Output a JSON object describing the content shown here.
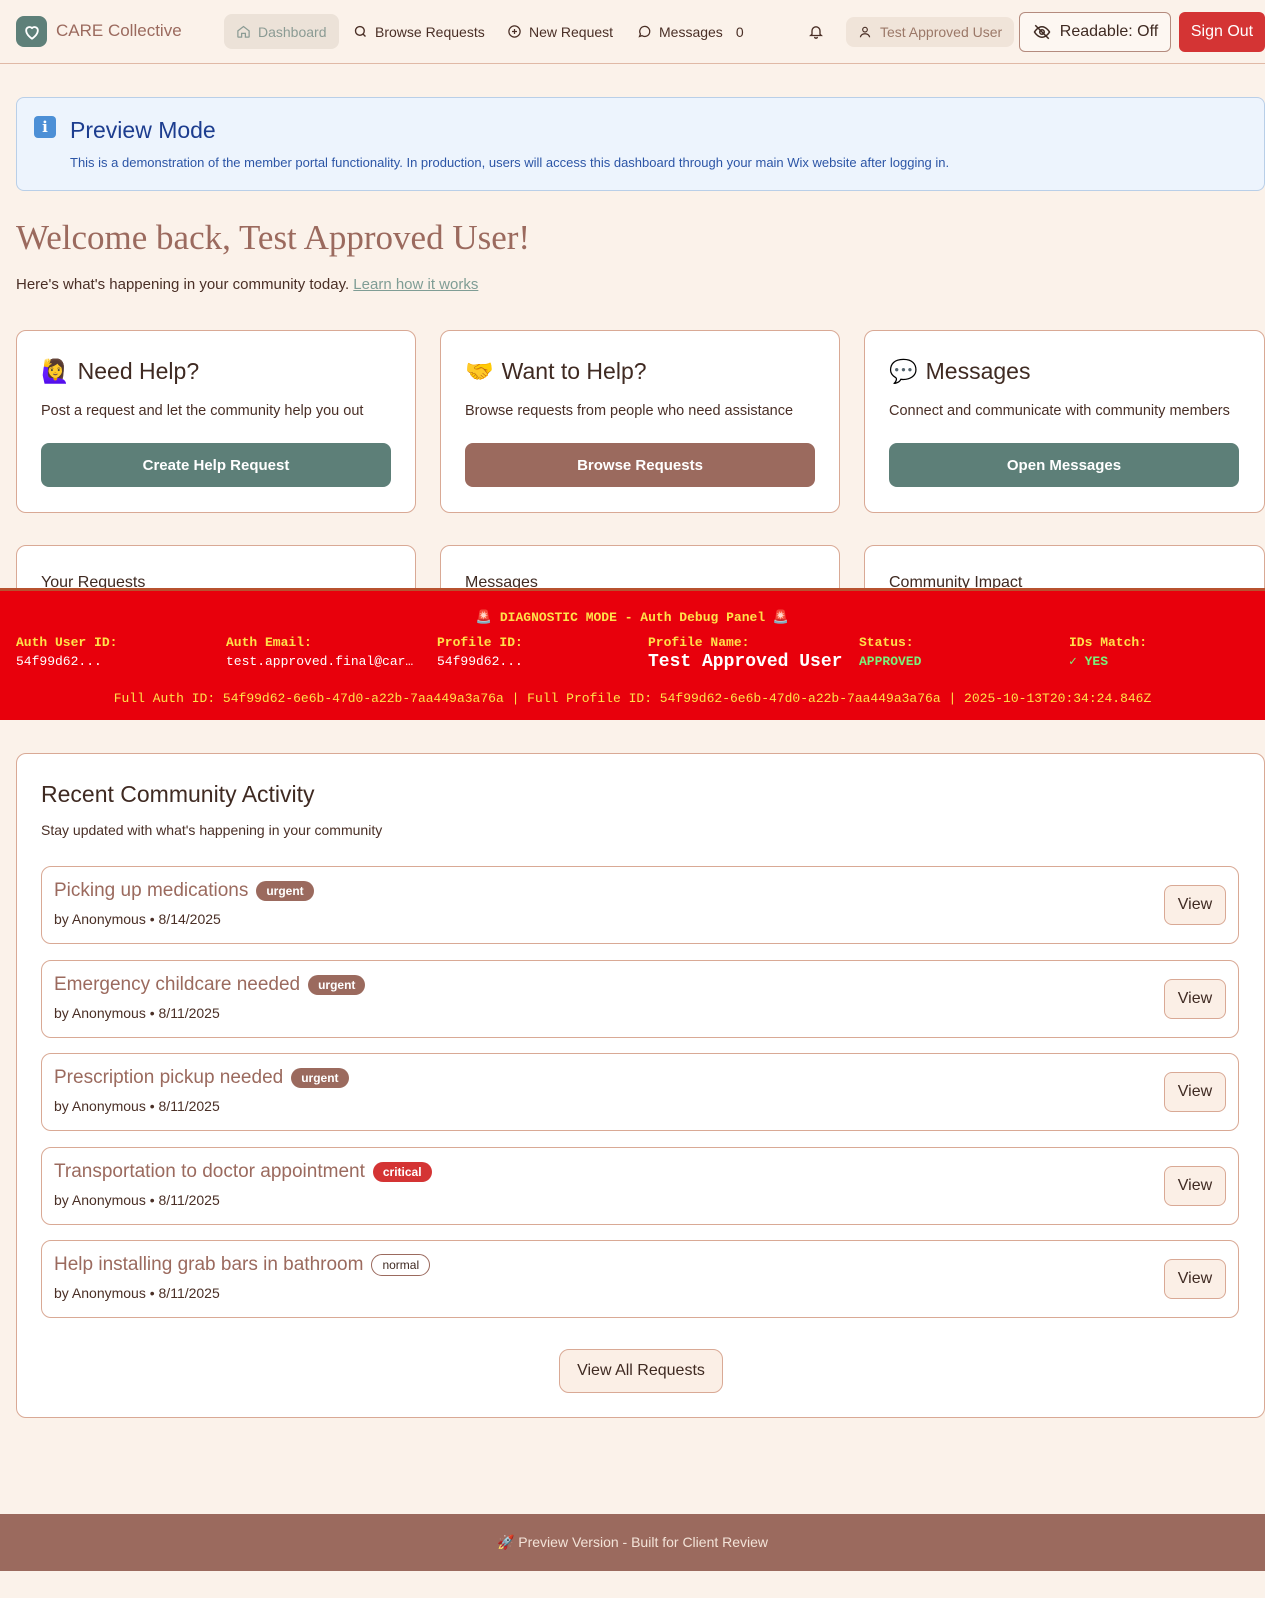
{
  "nav": {
    "brand": "CARE Collective",
    "items": [
      {
        "label": "Dashboard",
        "icon": "home-icon"
      },
      {
        "label": "Browse Requests",
        "icon": "search-icon"
      },
      {
        "label": "New Request",
        "icon": "plus-circle-icon"
      },
      {
        "label": "Messages",
        "icon": "message-icon"
      }
    ],
    "message_count": "0",
    "user": "Test Approved User",
    "readable": "Readable: Off",
    "signout": "Sign Out"
  },
  "preview": {
    "title": "Preview Mode",
    "text": "This is a demonstration of the member portal functionality. In production, users will access this dashboard through your main Wix website after logging in."
  },
  "welcome": {
    "title": "Welcome back, Test Approved User!",
    "subtitle": "Here's what's happening in your community today.",
    "link": "Learn how it works"
  },
  "actions": [
    {
      "emoji": "🙋‍♀️",
      "title": "Need Help?",
      "desc": "Post a request and let the community help you out",
      "button": "Create Help Request"
    },
    {
      "emoji": "🤝",
      "title": "Want to Help?",
      "desc": "Browse requests from people who need assistance",
      "button": "Browse Requests"
    },
    {
      "emoji": "💬",
      "title": "Messages",
      "desc": "Connect and communicate with community members",
      "button": "Open Messages"
    }
  ],
  "stats": [
    "Your Requests",
    "Messages",
    "Community Impact"
  ],
  "debug": {
    "title": "🚨 DIAGNOSTIC MODE - Auth Debug Panel 🚨",
    "fields": [
      {
        "label": "Auth User ID:",
        "value": "54f99d62..."
      },
      {
        "label": "Auth Email:",
        "value": "test.approved.final@car…"
      },
      {
        "label": "Profile ID:",
        "value": "54f99d62..."
      },
      {
        "label": "Profile Name:",
        "value": "Test Approved User"
      },
      {
        "label": "Status:",
        "value": "APPROVED"
      },
      {
        "label": "IDs Match:",
        "value": "✓ YES"
      }
    ],
    "footer": "Full Auth ID: 54f99d62-6e6b-47d0-a22b-7aa449a3a76a | Full Profile ID: 54f99d62-6e6b-47d0-a22b-7aa449a3a76a | 2025-10-13T20:34:24.846Z"
  },
  "activity": {
    "title": "Recent Community Activity",
    "subtitle": "Stay updated with what's happening in your community",
    "requests": [
      {
        "title": "Picking up medications",
        "badge": "urgent",
        "meta": "by Anonymous • 8/14/2025",
        "button": "View"
      },
      {
        "title": "Emergency childcare needed",
        "badge": "urgent",
        "meta": "by Anonymous • 8/11/2025",
        "button": "View"
      },
      {
        "title": "Prescription pickup needed",
        "badge": "urgent",
        "meta": "by Anonymous • 8/11/2025",
        "button": "View"
      },
      {
        "title": "Transportation to doctor appointment",
        "badge": "critical",
        "meta": "by Anonymous • 8/11/2025",
        "button": "View"
      },
      {
        "title": "Help installing grab bars in bathroom",
        "badge": "normal",
        "meta": "by Anonymous • 8/11/2025",
        "button": "View"
      }
    ],
    "view_all": "View All Requests"
  },
  "footer": "🚀 Preview Version - Built for Client Review",
  "colors": {
    "accent_teal": "#5d7f78",
    "accent_rose": "#9b6a5e",
    "danger": "#d43434",
    "debug_bg": "#e8000c"
  }
}
